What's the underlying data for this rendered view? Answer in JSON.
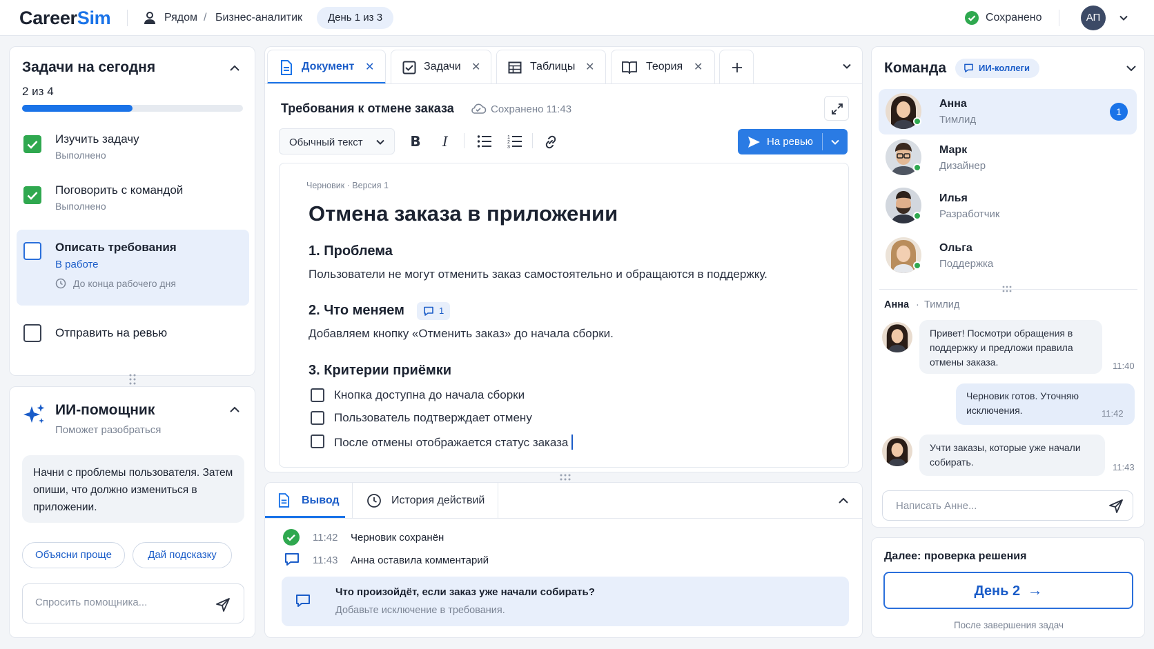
{
  "header": {
    "logo_part1": "Career",
    "logo_part2": "Sim",
    "user": "Рядом",
    "crumb_sep": "/",
    "role": "Бизнес-аналитик",
    "day_pill": "День 1 из 3",
    "saved": "Сохранено",
    "avatar": "АП"
  },
  "tasks": {
    "title": "Задачи на сегодня",
    "progress_text": "2 из 4",
    "progress": 0.5,
    "items": [
      {
        "title": "Изучить задачу",
        "status": "Выполнено"
      },
      {
        "title": "Поговорить с командой",
        "status": "Выполнено"
      },
      {
        "title": "Описать требования",
        "status": "В работе",
        "deadline": "До конца рабочего дня"
      },
      {
        "title": "Отправить на ревью",
        "status": ""
      }
    ]
  },
  "assistant": {
    "title": "ИИ-помощник",
    "subtitle": "Поможет разобраться",
    "message": "Начни с проблемы пользователя. Затем опиши, что должно измениться в приложении.",
    "btn_simple": "Объясни проще",
    "btn_hint": "Дай подсказку",
    "input_placeholder": "Спросить помощника..."
  },
  "editor": {
    "tabs": [
      {
        "label": "Документ",
        "icon": "document-icon"
      },
      {
        "label": "Задачи",
        "icon": "checkbox-icon"
      },
      {
        "label": "Таблицы",
        "icon": "table-icon"
      },
      {
        "label": "Теория",
        "icon": "book-icon"
      }
    ],
    "doc_title": "Требования к отмене заказа",
    "saved_at": "Сохранено 11:43",
    "text_style": "Обычный текст",
    "review_button": "На ревью",
    "meta": "Черновик · Версия 1",
    "heading": "Отмена заказа в приложении",
    "s1_title": "1. Проблема",
    "s1_text": "Пользователи не могут отменить заказ самостоятельно и обращаются в поддержку.",
    "s2_title": "2. Что меняем",
    "s2_comments": "1",
    "s2_text": "Добавляем кнопку «Отменить заказ» до начала сборки.",
    "s3_title": "3. Критерии приёмки",
    "criteria": [
      "Кнопка доступна до начала сборки",
      "Пользователь подтверждает отмену",
      "После отмены отображается статус заказа"
    ]
  },
  "output": {
    "tab_output": "Вывод",
    "tab_history": "История действий",
    "log": [
      {
        "time": "11:42",
        "text": "Черновик сохранён"
      },
      {
        "time": "11:43",
        "text": "Анна оставила комментарий"
      }
    ],
    "callout_title": "Что произойдёт, если заказ уже начали собирать?",
    "callout_text": "Добавьте исключение в требования."
  },
  "team": {
    "title": "Команда",
    "badge": "ИИ-коллеги",
    "members": [
      {
        "name": "Анна",
        "role": "Тимлид",
        "unread": "1"
      },
      {
        "name": "Марк",
        "role": "Дизайнер"
      },
      {
        "name": "Илья",
        "role": "Разработчик"
      },
      {
        "name": "Ольга",
        "role": "Поддержка"
      }
    ],
    "chat_with": "Анна",
    "chat_role": "Тимлид",
    "chat_sep": "·",
    "messages": [
      {
        "from": "Анна",
        "text": "Привет! Посмотри обращения в поддержку и предложи правила отмены заказа.",
        "time": "11:40"
      },
      {
        "from": "me",
        "text": "Черновик готов. Уточняю исключения.",
        "time": "11:42"
      },
      {
        "from": "Анна",
        "text": "Учти заказы, которые уже начали собирать.",
        "time": "11:43"
      }
    ],
    "input_placeholder": "Написать Анне..."
  },
  "next": {
    "title": "Далее: проверка решения",
    "button": "День 2",
    "note": "После завершения задач"
  },
  "colors": {
    "accent": "#1a73e8",
    "success": "#2fa84f",
    "selected_bg": "#e8effb"
  }
}
